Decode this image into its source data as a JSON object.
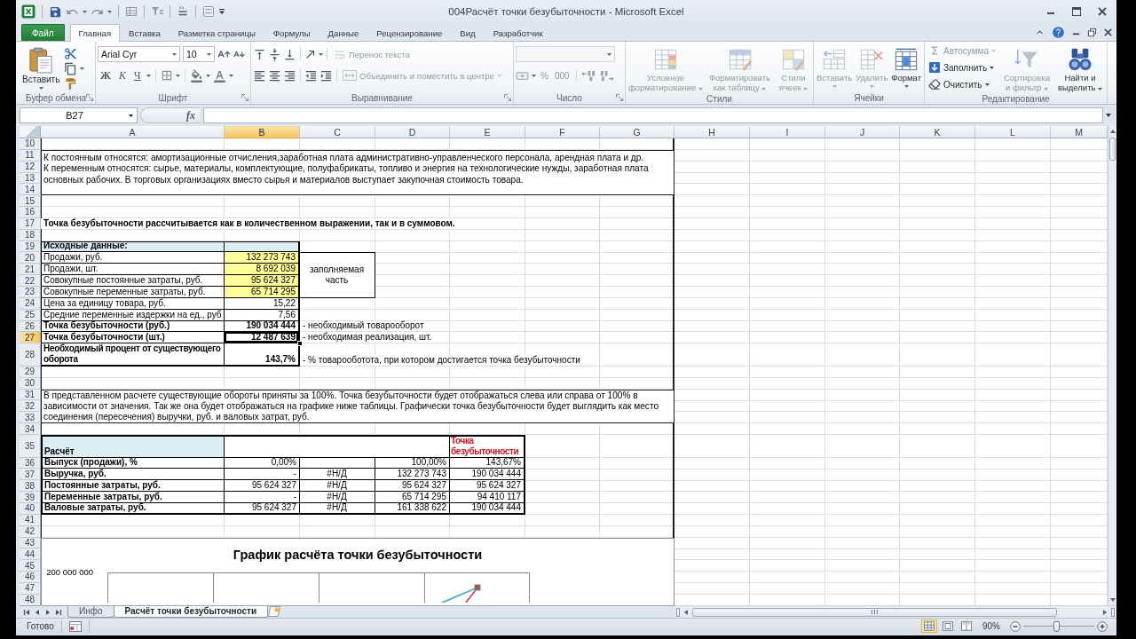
{
  "title_bar": {
    "title": "004Расчёт точки безубыточности - Microsoft Excel"
  },
  "ribbon_tabs": [
    {
      "label": "Файл",
      "kind": "file",
      "selected": false
    },
    {
      "label": "Главная",
      "kind": "tab",
      "selected": true
    },
    {
      "label": "Вставка",
      "kind": "tab",
      "selected": false
    },
    {
      "label": "Разметка страницы",
      "kind": "tab",
      "selected": false
    },
    {
      "label": "Формулы",
      "kind": "tab",
      "selected": false
    },
    {
      "label": "Данные",
      "kind": "tab",
      "selected": false
    },
    {
      "label": "Рецензирование",
      "kind": "tab",
      "selected": false
    },
    {
      "label": "Вид",
      "kind": "tab",
      "selected": false
    },
    {
      "label": "Разработчик",
      "kind": "tab",
      "selected": false
    }
  ],
  "ribbon": {
    "clipboard": {
      "label": "Буфер обмена",
      "paste": "Вставить"
    },
    "font": {
      "label": "Шрифт",
      "font_name": "Arial Cyr",
      "font_size": "10",
      "bold": "Ж",
      "italic": "К",
      "underline": "Ч"
    },
    "alignment": {
      "label": "Выравнивание",
      "wrap_text": {
        "text": "Перенос текста",
        "disabled": true
      },
      "merge": {
        "text": "Объединить и поместить в центре",
        "disabled": true
      }
    },
    "number": {
      "label": "Число",
      "disabled": true,
      "percent": "%",
      "thousands": "000"
    },
    "styles": {
      "label": "Стили",
      "buttons": [
        {
          "kind": "conditional",
          "text": "Условное форматирование",
          "disabled": true
        },
        {
          "kind": "table",
          "text": "Форматировать как таблицу",
          "disabled": true
        },
        {
          "kind": "cell_styles",
          "text": "Стили ячеек",
          "disabled": true
        }
      ]
    },
    "cells": {
      "label": "Ячейки",
      "buttons": [
        {
          "kind": "insert",
          "text": "Вставить",
          "disabled": true
        },
        {
          "kind": "delete",
          "text": "Удалить",
          "disabled": true
        },
        {
          "kind": "format",
          "text": "Формат",
          "disabled": false
        }
      ]
    },
    "editing": {
      "label": "Редактирование",
      "small_buttons": [
        {
          "kind": "autosum",
          "text": "Автосумма",
          "disabled": true
        },
        {
          "kind": "fill",
          "text": "Заполнить",
          "disabled": false
        },
        {
          "kind": "clear",
          "text": "Очистить",
          "disabled": false
        }
      ],
      "buttons": [
        {
          "kind": "sort",
          "text": "Сортировка и фильтр",
          "disabled": true
        },
        {
          "kind": "find",
          "text": "Найти и выделить",
          "disabled": false
        }
      ]
    }
  },
  "formula_bar": {
    "name_box": "B27",
    "function_label": "fx"
  },
  "sheet": {
    "columns": [
      {
        "label": "A",
        "selected": false
      },
      {
        "label": "B",
        "selected": true
      },
      {
        "label": "C",
        "selected": false
      },
      {
        "label": "D",
        "selected": false
      },
      {
        "label": "E",
        "selected": false
      },
      {
        "label": "F",
        "selected": false
      },
      {
        "label": "G",
        "selected": false
      },
      {
        "label": "H",
        "selected": false
      },
      {
        "label": "I",
        "selected": false
      },
      {
        "label": "J",
        "selected": false
      },
      {
        "label": "K",
        "selected": false
      },
      {
        "label": "L",
        "selected": false
      },
      {
        "label": "M",
        "selected": false
      }
    ],
    "rows": [
      {
        "number": "10",
        "selected": false
      },
      {
        "number": "11",
        "selected": false
      },
      {
        "number": "12",
        "selected": false
      },
      {
        "number": "13",
        "selected": false
      },
      {
        "number": "14",
        "selected": false
      },
      {
        "number": "15",
        "selected": false
      },
      {
        "number": "16",
        "selected": false
      },
      {
        "number": "17",
        "selected": false
      },
      {
        "number": "18",
        "selected": false
      },
      {
        "number": "19",
        "selected": false
      },
      {
        "number": "20",
        "selected": false
      },
      {
        "number": "21",
        "selected": false
      },
      {
        "number": "22",
        "selected": false
      },
      {
        "number": "23",
        "selected": false
      },
      {
        "number": "24",
        "selected": false
      },
      {
        "number": "25",
        "selected": false
      },
      {
        "number": "26",
        "selected": false
      },
      {
        "number": "27",
        "selected": true
      },
      {
        "number": "28",
        "selected": false
      },
      {
        "number": "29",
        "selected": false
      },
      {
        "number": "30",
        "selected": false
      },
      {
        "number": "31",
        "selected": false
      },
      {
        "number": "32",
        "selected": false
      },
      {
        "number": "33",
        "selected": false
      },
      {
        "number": "34",
        "selected": false
      },
      {
        "number": "35",
        "selected": false
      },
      {
        "number": "36",
        "selected": false
      },
      {
        "number": "37",
        "selected": false
      },
      {
        "number": "38",
        "selected": false
      },
      {
        "number": "39",
        "selected": false
      },
      {
        "number": "40",
        "selected": false
      },
      {
        "number": "41",
        "selected": false
      },
      {
        "number": "42",
        "selected": false
      },
      {
        "number": "43",
        "selected": false
      },
      {
        "number": "44",
        "selected": false
      },
      {
        "number": "45",
        "selected": false
      },
      {
        "number": "46",
        "selected": false
      },
      {
        "number": "47",
        "selected": false
      },
      {
        "number": "48",
        "selected": false
      }
    ],
    "notes": [
      "К постоянным относятся: амортизационные отчисления,заработная плата административно-управленческого персонала, арендная плата и др.",
      "К переменным относятся: сырье, материалы, комплектующие, полуфабрикаты, топливо и энергия на технологические нужды, заработная плата основных рабочих. В торговых организациях вместо сырья и материалов выступает закупочная стоимость товара."
    ],
    "heading": "Точка безубыточности рассчитывается как в количественном выражении, так и в суммовом.",
    "input_table": {
      "title": "Исходные данные:",
      "note": "заполняемая часть",
      "rows": [
        {
          "kind": "input",
          "label": "Продажи, руб.",
          "value": "132 273 743",
          "selected": false
        },
        {
          "kind": "input",
          "label": "Продажи, шт.",
          "value": "8 692 039",
          "selected": false
        },
        {
          "kind": "input",
          "label": "Совокупные постоянные затраты, руб.",
          "value": "95 624 327",
          "selected": false
        },
        {
          "kind": "input",
          "label": "Совокупные переменные затраты, руб.",
          "value": "65 714 295",
          "selected": false
        },
        {
          "kind": "derived",
          "label": "Цена за единицу товара, руб.",
          "value": "15,22",
          "selected": false
        },
        {
          "kind": "derived",
          "label": "Средние переменные издержки на ед., руб",
          "value": "7,56",
          "selected": false
        },
        {
          "kind": "result",
          "label": "Точка безубыточности (руб.)",
          "value": "190 034 444",
          "comment": "- необходимый товарооборот",
          "selected": false
        },
        {
          "kind": "result",
          "label": "Точка безубыточности (шт.)",
          "value": "12 487 639",
          "comment": "- необходимая реализация, шт.",
          "selected": true
        },
        {
          "kind": "result",
          "label": "Необходимый процент от существующего оборота",
          "value": "143,7%",
          "comment": "- % товарооботота, при котором достигается точка безубыточности",
          "selected": false
        }
      ]
    },
    "explanation": "В представленном расчете существующие обороты приняты за 100%. Точка безубыточности будет отображаться слева или справа от 100% в зависимости от значения. Так же она будет отображаться на графике ниже таблицы. Графически точка безубыточности будет выглядить как место соединения (пересечения) выручки, руб. и валовых затрат, руб.",
    "calc_table": {
      "title": "Расчёт",
      "break_even_label": "Точка безубыточности",
      "rows": [
        {
          "label": "Выпуск (продажи), %",
          "column_b": "0,00%",
          "column_d": "100,00%",
          "column_e": "143,67%"
        },
        {
          "label": "Выручка, руб.",
          "column_b": "-",
          "column_c": "#Н/Д",
          "column_d": "132 273 743",
          "column_e": "190 034 444"
        },
        {
          "label": "Постоянные затраты, руб.",
          "column_b": "95 624 327",
          "column_c": "#Н/Д",
          "column_d": "95 624 327",
          "column_e": "95 624 327"
        },
        {
          "label": "Переменные затраты, руб.",
          "column_b": "-",
          "column_c": "#Н/Д",
          "column_d": "65 714 295",
          "column_e": "94 410 117"
        },
        {
          "label": "Валовые затраты, руб.",
          "column_b": "95 624 327",
          "column_c": "#Н/Д",
          "column_d": "161 338 622",
          "column_e": "190 034 444"
        }
      ]
    },
    "chart": {
      "title": "График расчёта точки безубыточности",
      "y_axis_labels": [
        "200 000 000"
      ]
    }
  },
  "sheet_tabs": [
    {
      "label": "Инфо",
      "selected": false
    },
    {
      "label": "Расчёт точки безубыточности",
      "selected": true
    }
  ],
  "status_bar": {
    "status": "Готово",
    "views": [
      {
        "kind": "normal",
        "selected": true
      },
      {
        "kind": "page_layout",
        "selected": false
      },
      {
        "kind": "page_break",
        "selected": false
      }
    ],
    "zoom": "90%",
    "zoom_slider": {
      "level": 0.46
    }
  }
}
